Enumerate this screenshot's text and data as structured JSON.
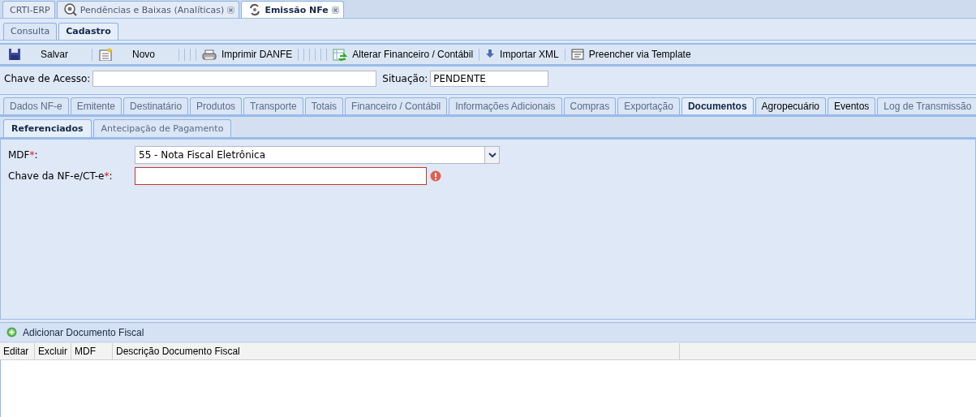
{
  "app_tabs": [
    {
      "label": "CRTI-ERP",
      "selected": false,
      "closable": false
    },
    {
      "label": "Pendências e Baixas (Analíticas)",
      "selected": false,
      "closable": true
    },
    {
      "label": "Emissão NFe",
      "selected": true,
      "closable": true
    }
  ],
  "mode_tabs": [
    {
      "label": "Consulta",
      "selected": false
    },
    {
      "label": "Cadastro",
      "selected": true
    }
  ],
  "toolbar": [
    {
      "label": "Salvar"
    },
    {
      "label": "Novo"
    },
    {
      "label": "Imprimir DANFE"
    },
    {
      "label": "Alterar Financeiro / Contábil"
    },
    {
      "label": "Importar XML"
    },
    {
      "label": "Preencher via Template"
    }
  ],
  "header_fields": [
    {
      "label": "Chave de Acesso:"
    },
    {
      "label": "Situação:",
      "value": "PENDENTE"
    }
  ],
  "section_tabs": [
    {
      "label": "Dados NF-e",
      "selected": false,
      "emphasized": false
    },
    {
      "label": "Emitente",
      "selected": false,
      "emphasized": false
    },
    {
      "label": "Destinatário",
      "selected": false,
      "emphasized": false
    },
    {
      "label": "Produtos",
      "selected": false,
      "emphasized": false
    },
    {
      "label": "Transporte",
      "selected": false,
      "emphasized": false
    },
    {
      "label": "Totais",
      "selected": false,
      "emphasized": false
    },
    {
      "label": "Financeiro / Contábil",
      "selected": false,
      "emphasized": false
    },
    {
      "label": "Informações Adicionais",
      "selected": false,
      "emphasized": false
    },
    {
      "label": "Compras",
      "selected": false,
      "emphasized": false
    },
    {
      "label": "Exportação",
      "selected": false,
      "emphasized": false
    },
    {
      "label": "Documentos",
      "selected": true,
      "emphasized": false
    },
    {
      "label": "Agropecuário",
      "selected": false,
      "emphasized": true
    },
    {
      "label": "Eventos",
      "selected": false,
      "emphasized": true
    },
    {
      "label": "Log de Transmissão",
      "selected": false,
      "emphasized": false
    }
  ],
  "sub_tabs": [
    {
      "label": "Referenciados",
      "selected": true
    },
    {
      "label": "Antecipação de Pagamento",
      "selected": false
    }
  ],
  "form_fields": [
    {
      "kind": "select",
      "label": "MDF",
      "required_mark": "*",
      "colon": ":",
      "value": "55 - Nota Fiscal Eletrônica",
      "invalid": false
    },
    {
      "kind": "text",
      "label": "Chave da NF-e/CT-e",
      "required_mark": "*",
      "colon": ":",
      "invalid": true
    }
  ],
  "add_button": {
    "label": "Adicionar Documento Fiscal"
  },
  "table": {
    "columns": [
      "Editar",
      "Excluir",
      "MDF",
      "Descrição Documento Fiscal"
    ]
  }
}
